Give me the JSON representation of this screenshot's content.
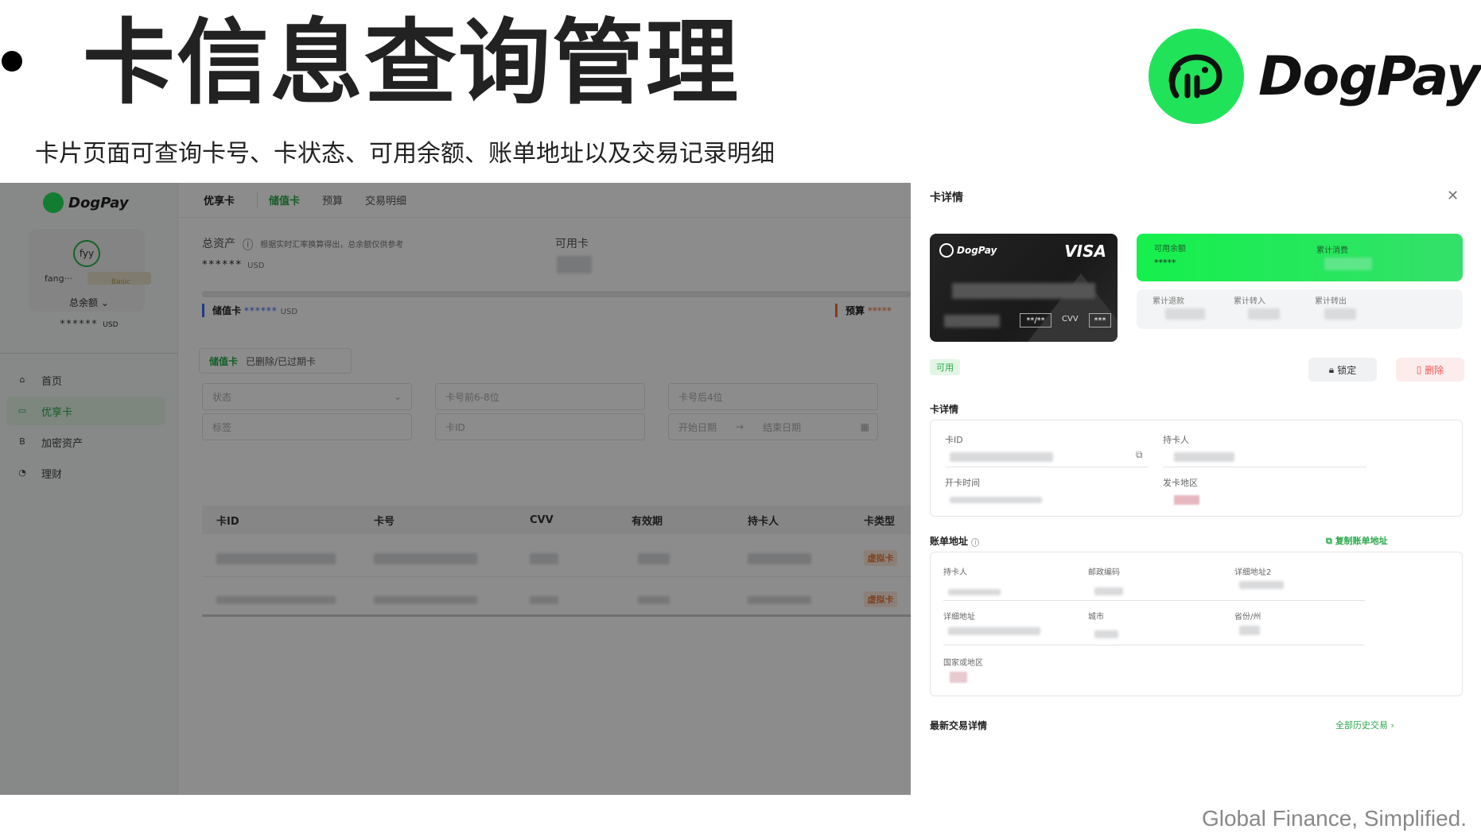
{
  "slide": {
    "title": "卡信息查询管理",
    "subtitle": "卡片页面可查询卡号、卡状态、可用余额、账单地址以及交易记录明细",
    "brand": "DogPay",
    "tagline": "Global Finance, Simplified."
  },
  "app": {
    "brand": "DogPay",
    "profile": {
      "avatar": "fyy",
      "name": "fang···",
      "badge": "Basic"
    },
    "sidebar": {
      "total_label": "总余额",
      "total_value": "******",
      "total_unit": "USD",
      "items": [
        {
          "label": "首页",
          "icon": "home-icon"
        },
        {
          "label": "优享卡",
          "icon": "card-icon"
        },
        {
          "label": "加密资产",
          "icon": "crypto-icon"
        },
        {
          "label": "理财",
          "icon": "wealth-icon"
        }
      ]
    },
    "tabs": [
      "优享卡",
      "储值卡",
      "预算",
      "交易明细"
    ],
    "assets": {
      "label": "总资产",
      "hint": "根据实时汇率换算得出，总余额仅供参考",
      "value": "******",
      "unit": "USD",
      "available_label": "可用卡"
    },
    "progress": {
      "stored_label": "储值卡",
      "stored_value": "******",
      "stored_unit": "USD",
      "budget_label": "预算",
      "budget_value": "*****"
    },
    "subtabs": [
      "储值卡",
      "已删除/已过期卡"
    ],
    "filters": {
      "status": "状态",
      "prefix": "卡号前6-8位",
      "suffix": "卡号后4位",
      "tag": "标签",
      "card_id": "卡ID",
      "start": "开始日期",
      "end": "结束日期"
    },
    "table": {
      "headers": [
        "卡ID",
        "卡号",
        "CVV",
        "有效期",
        "持卡人",
        "卡类型"
      ],
      "rows": [
        {
          "type": "虚拟卡"
        },
        {
          "type": "虚拟卡"
        }
      ]
    }
  },
  "drawer": {
    "title": "卡详情",
    "card": {
      "brand": "DogPay",
      "network": "VISA",
      "expiry": "**/**",
      "cvv_label": "CVV",
      "cvv": "***"
    },
    "balance": {
      "available_label": "可用余额",
      "available_value": "*****",
      "spent_label": "累计消费"
    },
    "stats": {
      "refund_label": "累计退款",
      "in_label": "累计转入",
      "out_label": "累计转出"
    },
    "status": "可用",
    "lock": "锁定",
    "delete": "删除",
    "details": {
      "section": "卡详情",
      "card_id": "卡ID",
      "holder": "持卡人",
      "open_time": "开卡时间",
      "region": "发卡地区"
    },
    "billing": {
      "section": "账单地址",
      "copy": "复制账单地址",
      "holder": "持卡人",
      "zip": "邮政编码",
      "addr2": "详细地址2",
      "addr": "详细地址",
      "city": "城市",
      "province": "省份/州",
      "country": "国家或地区"
    },
    "tx": {
      "section": "最新交易详情",
      "all": "全部历史交易 ›"
    }
  },
  "colors": {
    "brand_green": "#21e35a",
    "accent_green": "#2aa84a",
    "danger": "#e55555"
  }
}
